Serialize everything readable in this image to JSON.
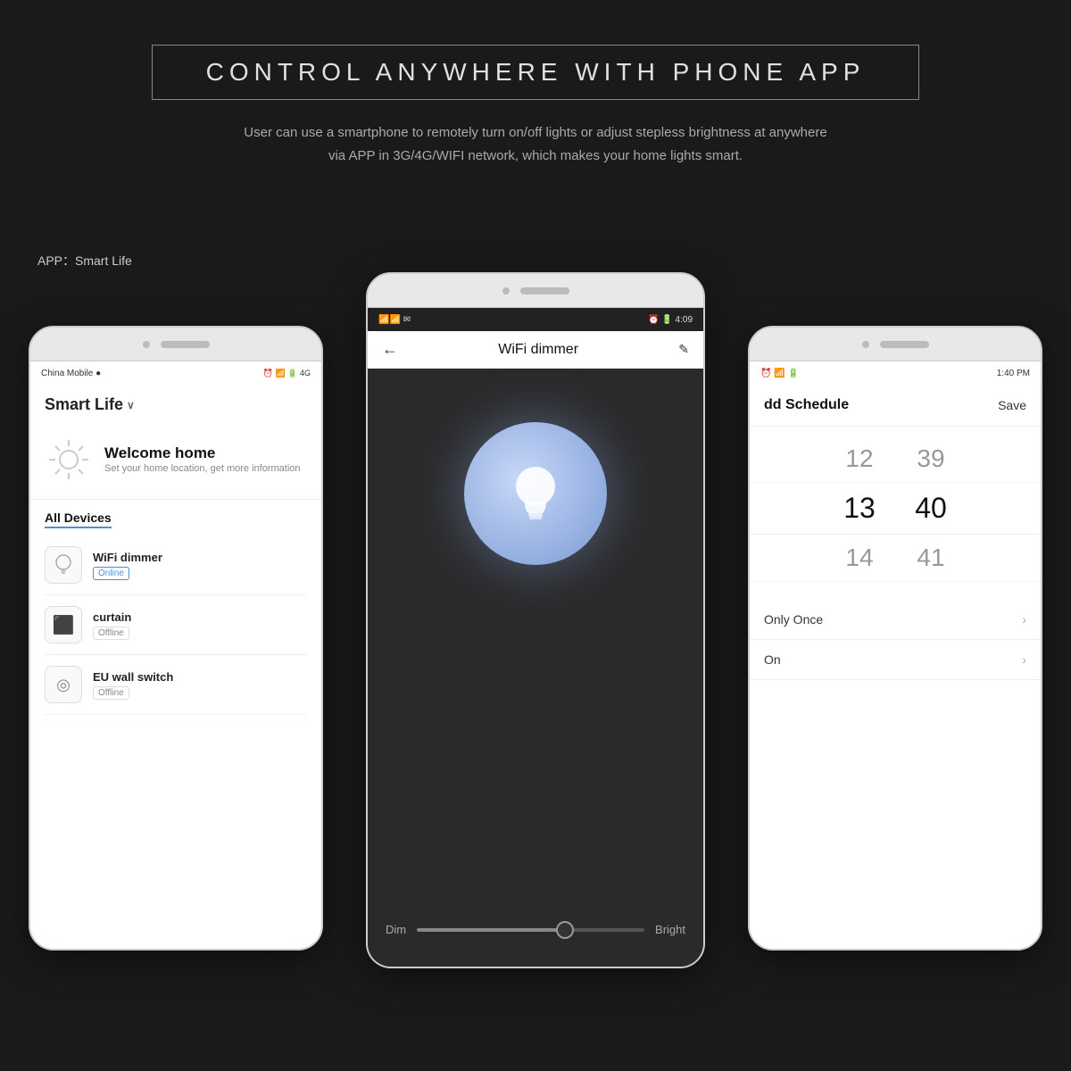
{
  "header": {
    "title": "CONTROL ANYWHERE WITH PHONE APP",
    "subtitle_line1": "User can use a smartphone to remotely turn on/off lights or adjust stepless brightness at anywhere",
    "subtitle_line2": "via APP in 3G/4G/WIFI network, which makes your home lights smart."
  },
  "app_label": "APP：Smart Life",
  "phones": {
    "left": {
      "status_bar": {
        "left": "China Mobile ●",
        "right": "⊙ 📶 🔋 4G"
      },
      "app_title": "Smart Life",
      "app_title_suffix": " ∨",
      "welcome_title": "Welcome home",
      "welcome_subtitle": "Set your home location, get more information",
      "devices_title": "All Devices",
      "devices": [
        {
          "name": "WiFi dimmer",
          "status": "Online",
          "status_type": "online"
        },
        {
          "name": "curtain",
          "status": "Offline",
          "status_type": "offline"
        },
        {
          "name": "EU wall switch",
          "status": "Offline",
          "status_type": "offline"
        }
      ]
    },
    "middle": {
      "status_bar": {
        "left": "📶📶 4:09",
        "right": "🔋"
      },
      "title": "WiFi dimmer",
      "dim_label": "Dim",
      "bright_label": "Bright",
      "slider_percent": 65
    },
    "right": {
      "status_bar": {
        "left": "⊙ 📶 🔋",
        "right": "1:40 PM"
      },
      "schedule_title": "dd Schedule",
      "save_label": "Save",
      "times": [
        {
          "hour": "12",
          "minute": "39",
          "active": false
        },
        {
          "hour": "13",
          "minute": "40",
          "active": true
        },
        {
          "hour": "14",
          "minute": "41",
          "active": false
        }
      ],
      "options": [
        {
          "label": "Only Once",
          "value": "›"
        },
        {
          "label": "On",
          "value": "›"
        }
      ]
    }
  }
}
